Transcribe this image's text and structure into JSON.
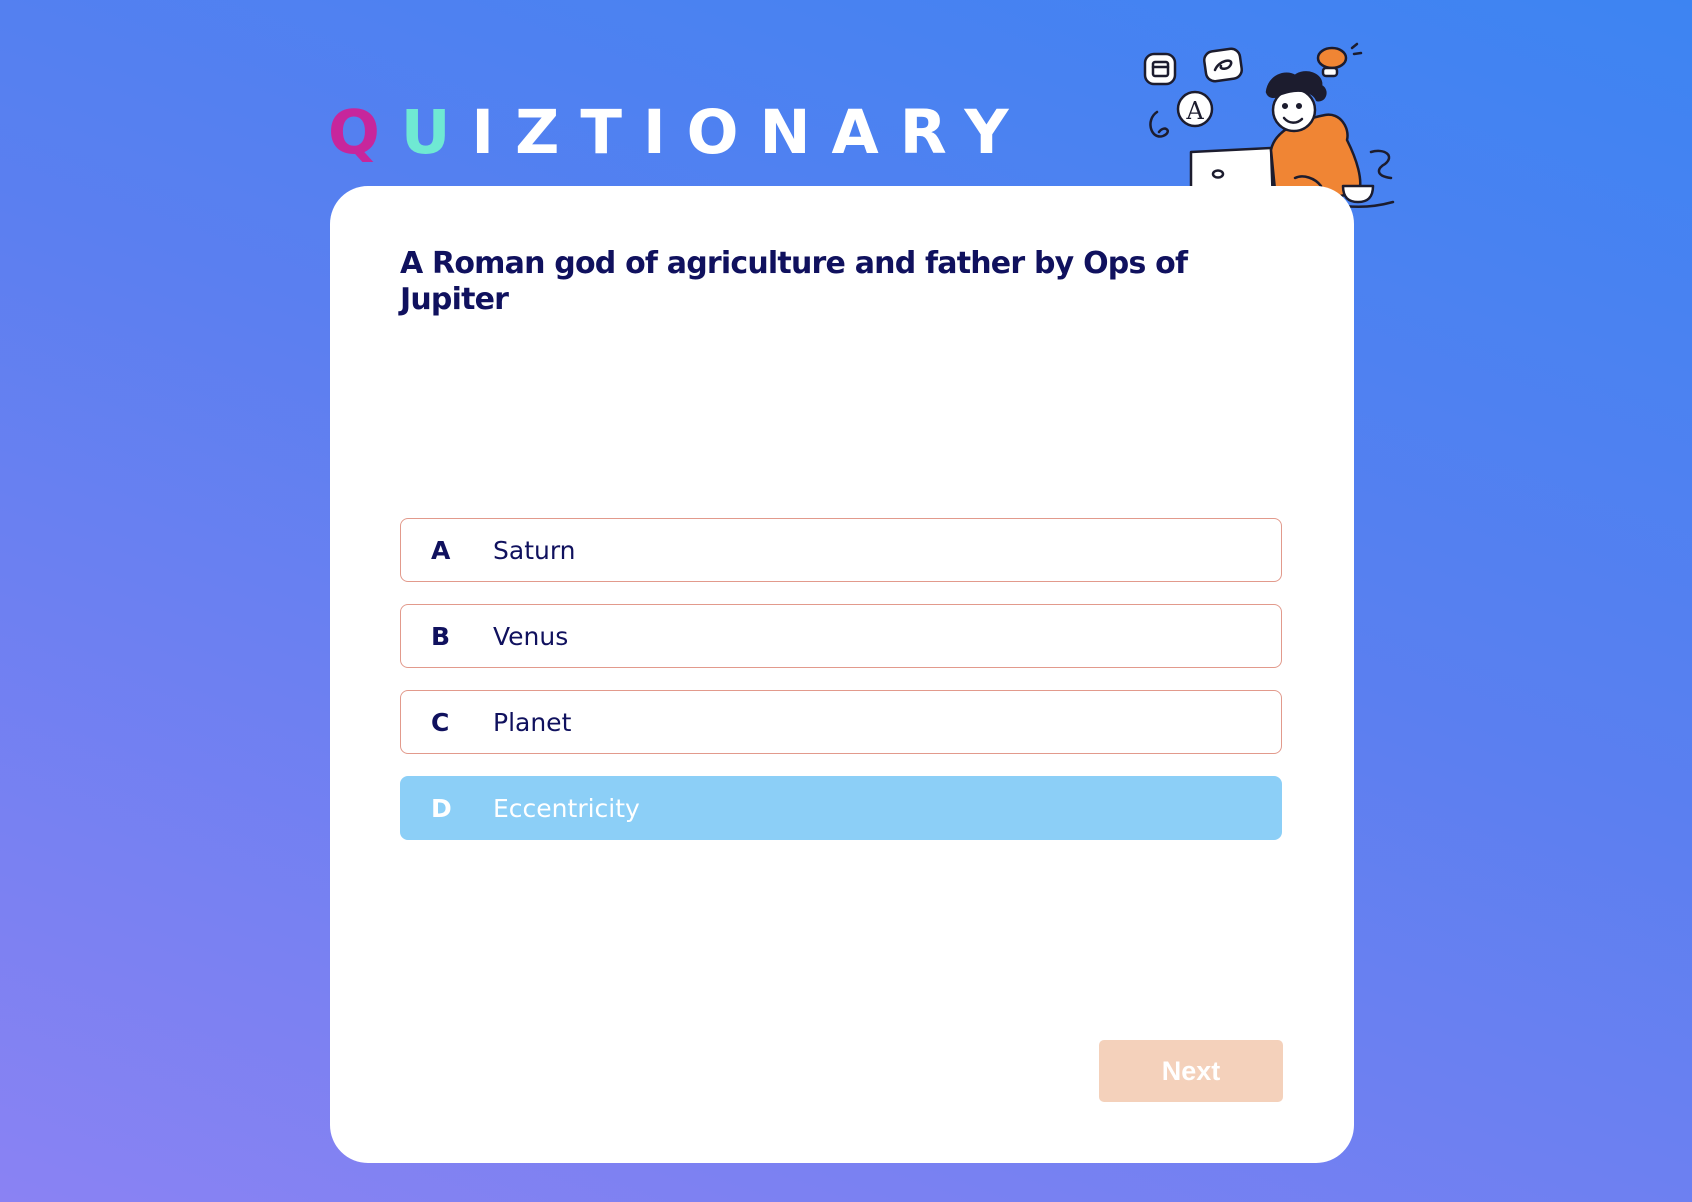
{
  "app": {
    "logo_first": "Q",
    "logo_second": "U",
    "logo_rest": "IZTIONARY"
  },
  "quiz": {
    "question": "A Roman god of agriculture and father by Ops of Jupiter",
    "options": [
      {
        "letter": "A",
        "text": "Saturn",
        "selected": false
      },
      {
        "letter": "B",
        "text": "Venus",
        "selected": false
      },
      {
        "letter": "C",
        "text": "Planet",
        "selected": false
      },
      {
        "letter": "D",
        "text": "Eccentricity",
        "selected": true
      }
    ],
    "next_label": "Next"
  },
  "illustration": {
    "badge_letter": "A",
    "icons": [
      "calendar-icon",
      "email-icon",
      "lightbulb-icon",
      "laptop-icon",
      "coffee-cup-icon"
    ]
  },
  "colors": {
    "accent_q": "#c7269c",
    "accent_u": "#6fe9d3",
    "question_text": "#10115e",
    "option_border": "#e29a8c",
    "selected_option": "#8ccff7",
    "next_button": "#f4d1bb",
    "illustration_shirt": "#f08534"
  }
}
